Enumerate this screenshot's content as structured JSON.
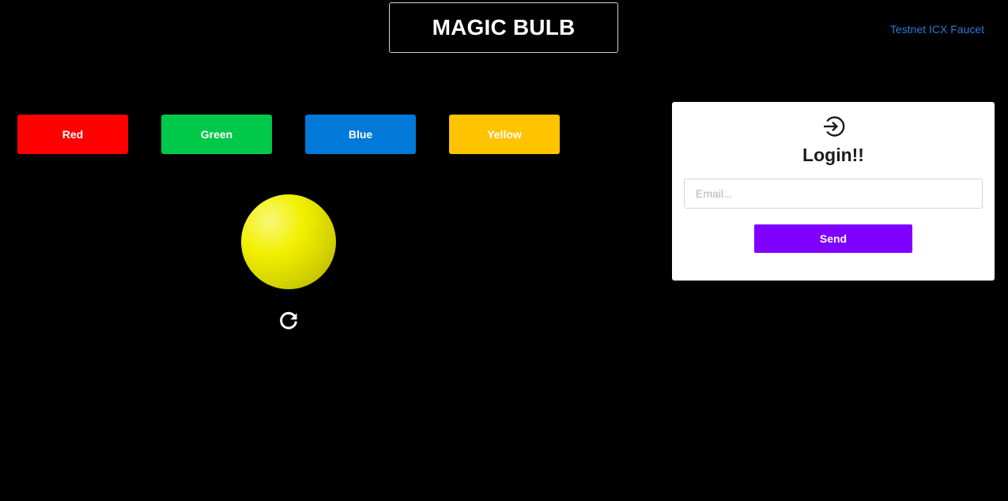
{
  "header": {
    "title": "MAGIC BULB",
    "faucet_link": "Testnet ICX Faucet"
  },
  "color_buttons": [
    {
      "label": "Red",
      "color": "#ff0000"
    },
    {
      "label": "Green",
      "color": "#00c94a"
    },
    {
      "label": "Blue",
      "color": "#0079d9"
    },
    {
      "label": "Yellow",
      "color": "#ffc300"
    }
  ],
  "bulb": {
    "current_color": "#f2f000",
    "reset_icon": "refresh-icon"
  },
  "login": {
    "icon": "sign-in-icon",
    "title": "Login!!",
    "email_placeholder": "Email...",
    "email_value": "",
    "send_label": "Send",
    "send_color": "#7f00ff"
  },
  "colors": {
    "background": "#000000",
    "link": "#2b79d6",
    "card": "#ffffff"
  }
}
